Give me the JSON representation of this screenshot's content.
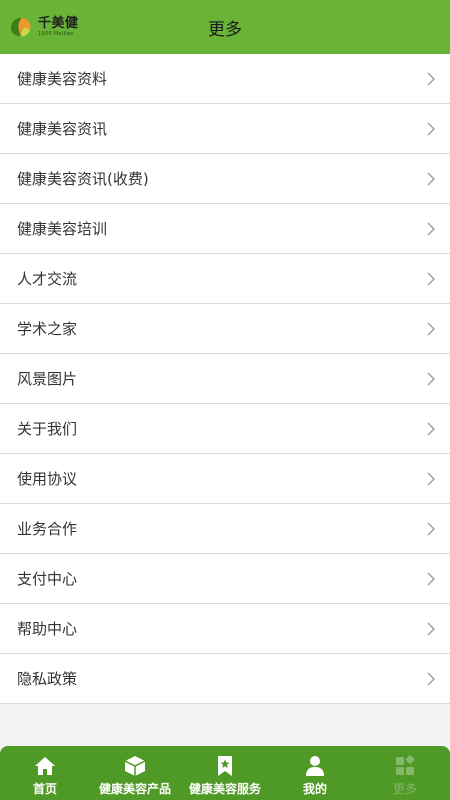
{
  "header": {
    "logo_cn": "千美健",
    "logo_en": "1000 MeiJian",
    "title": "更多"
  },
  "menu": [
    {
      "label": "健康美容资料"
    },
    {
      "label": "健康美容资讯"
    },
    {
      "label": "健康美容资讯(收费)"
    },
    {
      "label": "健康美容培训"
    },
    {
      "label": "人才交流"
    },
    {
      "label": "学术之家"
    },
    {
      "label": "风景图片"
    },
    {
      "label": "关于我们"
    },
    {
      "label": "使用协议"
    },
    {
      "label": "业务合作"
    },
    {
      "label": "支付中心"
    },
    {
      "label": "帮助中心"
    },
    {
      "label": "隐私政策"
    }
  ],
  "tabbar": [
    {
      "label": "首页",
      "icon": "home-icon"
    },
    {
      "label": "健康美容产品",
      "icon": "box-icon"
    },
    {
      "label": "健康美容服务",
      "icon": "bookmark-star-icon"
    },
    {
      "label": "我的",
      "icon": "person-icon"
    },
    {
      "label": "更多",
      "icon": "grid-icon",
      "active": true
    }
  ],
  "colors": {
    "brand_green": "#69b336",
    "tabbar_green": "#4f9a26",
    "active_tab_text": "#86b86a"
  }
}
